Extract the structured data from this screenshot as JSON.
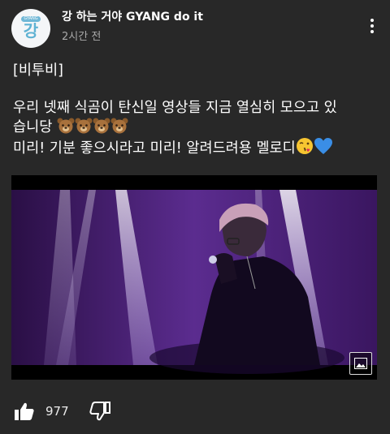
{
  "channel": {
    "name": "강 하는 거야 GYANG do it",
    "avatar_text": "강",
    "avatar_badge": "GYANG",
    "time": "2시간 전"
  },
  "post": {
    "line1": "[비투비]",
    "line2": "우리 넷째 식곰이 탄신일 영상들 지금 열심히 모으고 있",
    "line3_text": "습니당",
    "line4_text": "미리! 기분 좋으시라고 미리! 알려드려용 멜로디",
    "emojis": [
      "bear-face",
      "bear-face",
      "bear-face",
      "bear-face",
      "kissing-face",
      "blue-heart"
    ]
  },
  "likes": {
    "count": "977"
  },
  "colors": {
    "background": "#282828",
    "text_secondary": "#aaaaaa",
    "accent_purple": "#5a2a8a",
    "avatar_blue": "#5fb2d3"
  }
}
